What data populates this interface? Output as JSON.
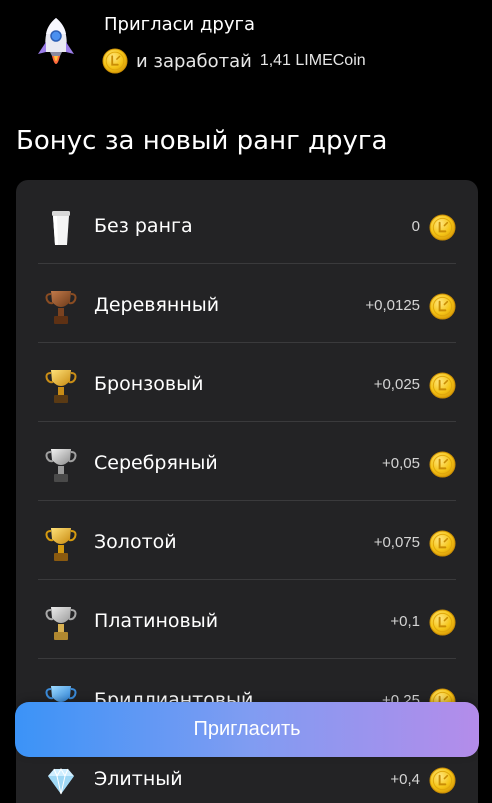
{
  "header": {
    "title": "Пригласи друга",
    "subtitle_prefix": "и заработай",
    "amount": "1,41 LIMECoin"
  },
  "section_title": "Бонус за новый ранг друга",
  "ranks": [
    {
      "name": "Без ранга",
      "bonus": "0",
      "icon": "cup-icon"
    },
    {
      "name": "Деревянный",
      "bonus": "+0,0125",
      "icon": "wooden-trophy-icon"
    },
    {
      "name": "Бронзовый",
      "bonus": "+0,025",
      "icon": "bronze-trophy-icon"
    },
    {
      "name": "Серебряный",
      "bonus": "+0,05",
      "icon": "silver-trophy-icon"
    },
    {
      "name": "Золотой",
      "bonus": "+0,075",
      "icon": "gold-trophy-icon"
    },
    {
      "name": "Платиновый",
      "bonus": "+0,1",
      "icon": "platinum-trophy-icon"
    },
    {
      "name": "Бриллиантовый",
      "bonus": "+0,25",
      "icon": "diamond-trophy-icon"
    },
    {
      "name": "Элитный",
      "bonus": "+0,4",
      "icon": "diamond-icon"
    }
  ],
  "invite_button": "Пригласить",
  "colors": {
    "background": "#000000",
    "card": "#232325",
    "coin": "#f5c518",
    "button_gradient_start": "#3b93f7",
    "button_gradient_end": "#b48cea"
  }
}
